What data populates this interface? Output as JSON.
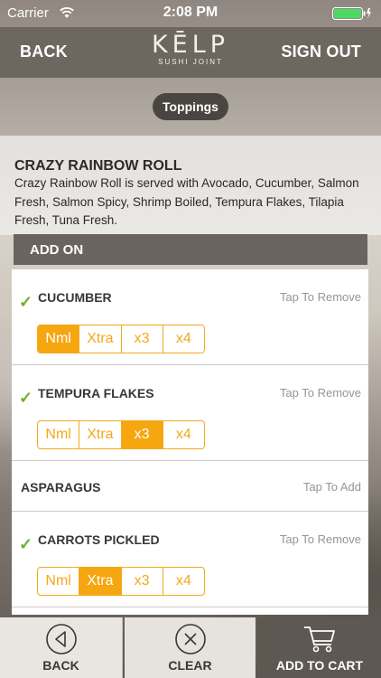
{
  "status_bar": {
    "carrier": "Carrier",
    "time": "2:08 PM"
  },
  "nav": {
    "back_label": "BACK",
    "signout_label": "SIGN OUT",
    "logo_text": "KĒLP",
    "logo_sub": "SUSHI JOINT"
  },
  "toppings_button": "Toppings",
  "item": {
    "title": "CRAZY RAINBOW ROLL",
    "description": "Crazy Rainbow Roll is served with Avocado, Cucumber, Salmon Fresh, Salmon Spicy, Shrimp Boiled, Tempura Flakes, Tilapia Fresh, Tuna Fresh."
  },
  "addon_header": "ADD ON",
  "addons": [
    {
      "name": "CUCUMBER",
      "action": "Tap To Remove",
      "checked": true,
      "options": [
        "Nml",
        "Xtra",
        "x3",
        "x4"
      ],
      "selected": "Nml"
    },
    {
      "name": "TEMPURA FLAKES",
      "action": "Tap To Remove",
      "checked": true,
      "options": [
        "Nml",
        "Xtra",
        "x3",
        "x4"
      ],
      "selected": "x3"
    },
    {
      "name": "ASPARAGUS",
      "action": "Tap To Add",
      "checked": false
    },
    {
      "name": "CARROTS PICKLED",
      "action": "Tap To Remove",
      "checked": true,
      "options": [
        "Nml",
        "Xtra",
        "x3",
        "x4"
      ],
      "selected": "Xtra"
    }
  ],
  "bottom_bar": {
    "back_label": "BACK",
    "clear_label": "CLEAR",
    "cart_label": "ADD TO CART"
  },
  "colors": {
    "accent": "#f6a60f",
    "check": "#6cae2f",
    "nav": "#6e6760"
  },
  "icons": {
    "check": "check-icon",
    "back": "back-circle-icon",
    "clear": "close-circle-icon",
    "cart": "cart-icon"
  }
}
